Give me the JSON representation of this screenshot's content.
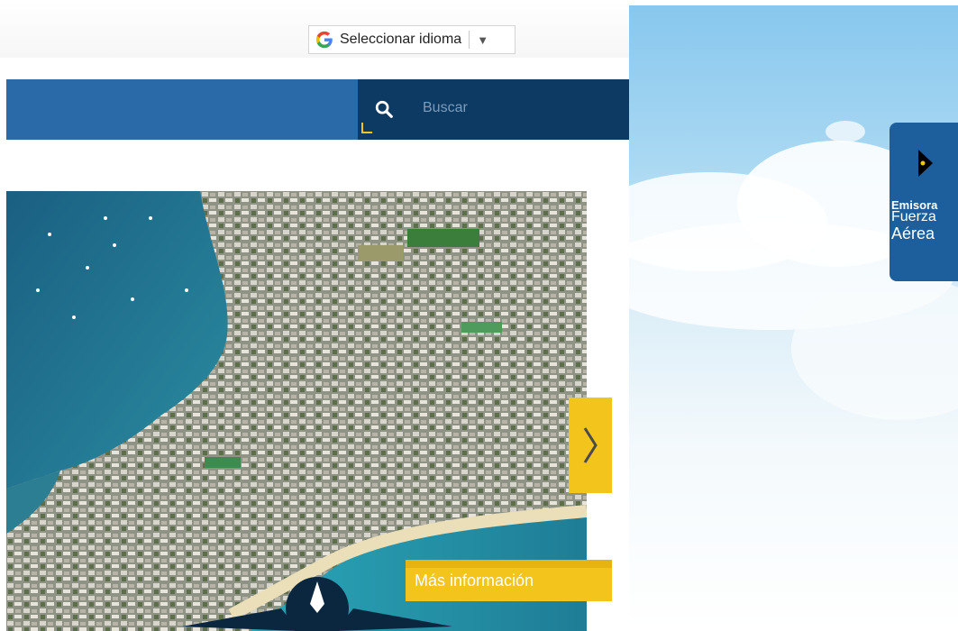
{
  "translate": {
    "label": "Seleccionar idioma",
    "arrow": "▼"
  },
  "search": {
    "placeholder": "Buscar"
  },
  "slider": {
    "more_info_label": "Más información",
    "next_glyph": "❯"
  },
  "radio": {
    "line1": "Emisora",
    "line2": "Fuerza",
    "line3": "Aérea"
  },
  "colors": {
    "nav_blue": "#2a6aa8",
    "search_dark": "#0d3a62",
    "accent_yellow": "#f2c41c",
    "radio_blue": "#1d5e9d"
  },
  "icons": [
    "google-logo-icon",
    "search-icon",
    "chevron-right-icon",
    "play-icon",
    "emblem-icon"
  ]
}
